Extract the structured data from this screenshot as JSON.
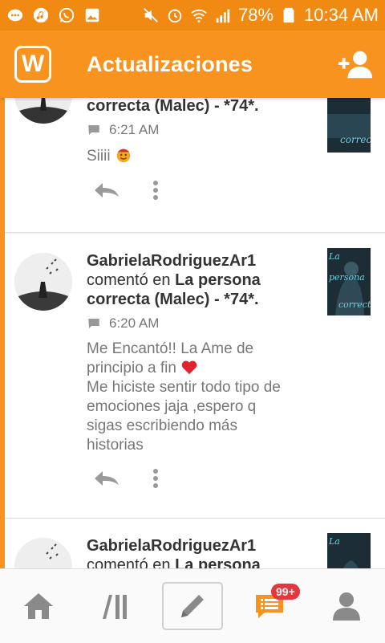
{
  "status_bar": {
    "battery": "78%",
    "time": "10:34 AM"
  },
  "app_bar": {
    "logo_letter": "W",
    "title": "Actualizaciones"
  },
  "feed": {
    "cards": [
      {
        "title_tail": "correcta (Malec) - *74*.",
        "time": "6:21 AM",
        "comment": "Siiii"
      },
      {
        "username": "GabrielaRodriguezAr1",
        "action": "comentó en",
        "story_title_1": "La persona",
        "story_title_2": "correcta (Malec) - *74*.",
        "time": "6:20 AM",
        "comment_lines": [
          "Me Encantó!! La Ame de",
          "principio a fin",
          "Me hiciste sentir todo tipo de",
          "emociones jaja ,espero q",
          "sigas escribiendo más",
          "historias"
        ]
      },
      {
        "username": "GabrielaRodriguezAr1",
        "action": "comentó en",
        "story_title_1": "La persona"
      }
    ]
  },
  "bottom_nav": {
    "badge": "99+"
  },
  "colors": {
    "accent": "#f7931e",
    "status_bar": "#f08a12",
    "badge": "#e0383e"
  }
}
